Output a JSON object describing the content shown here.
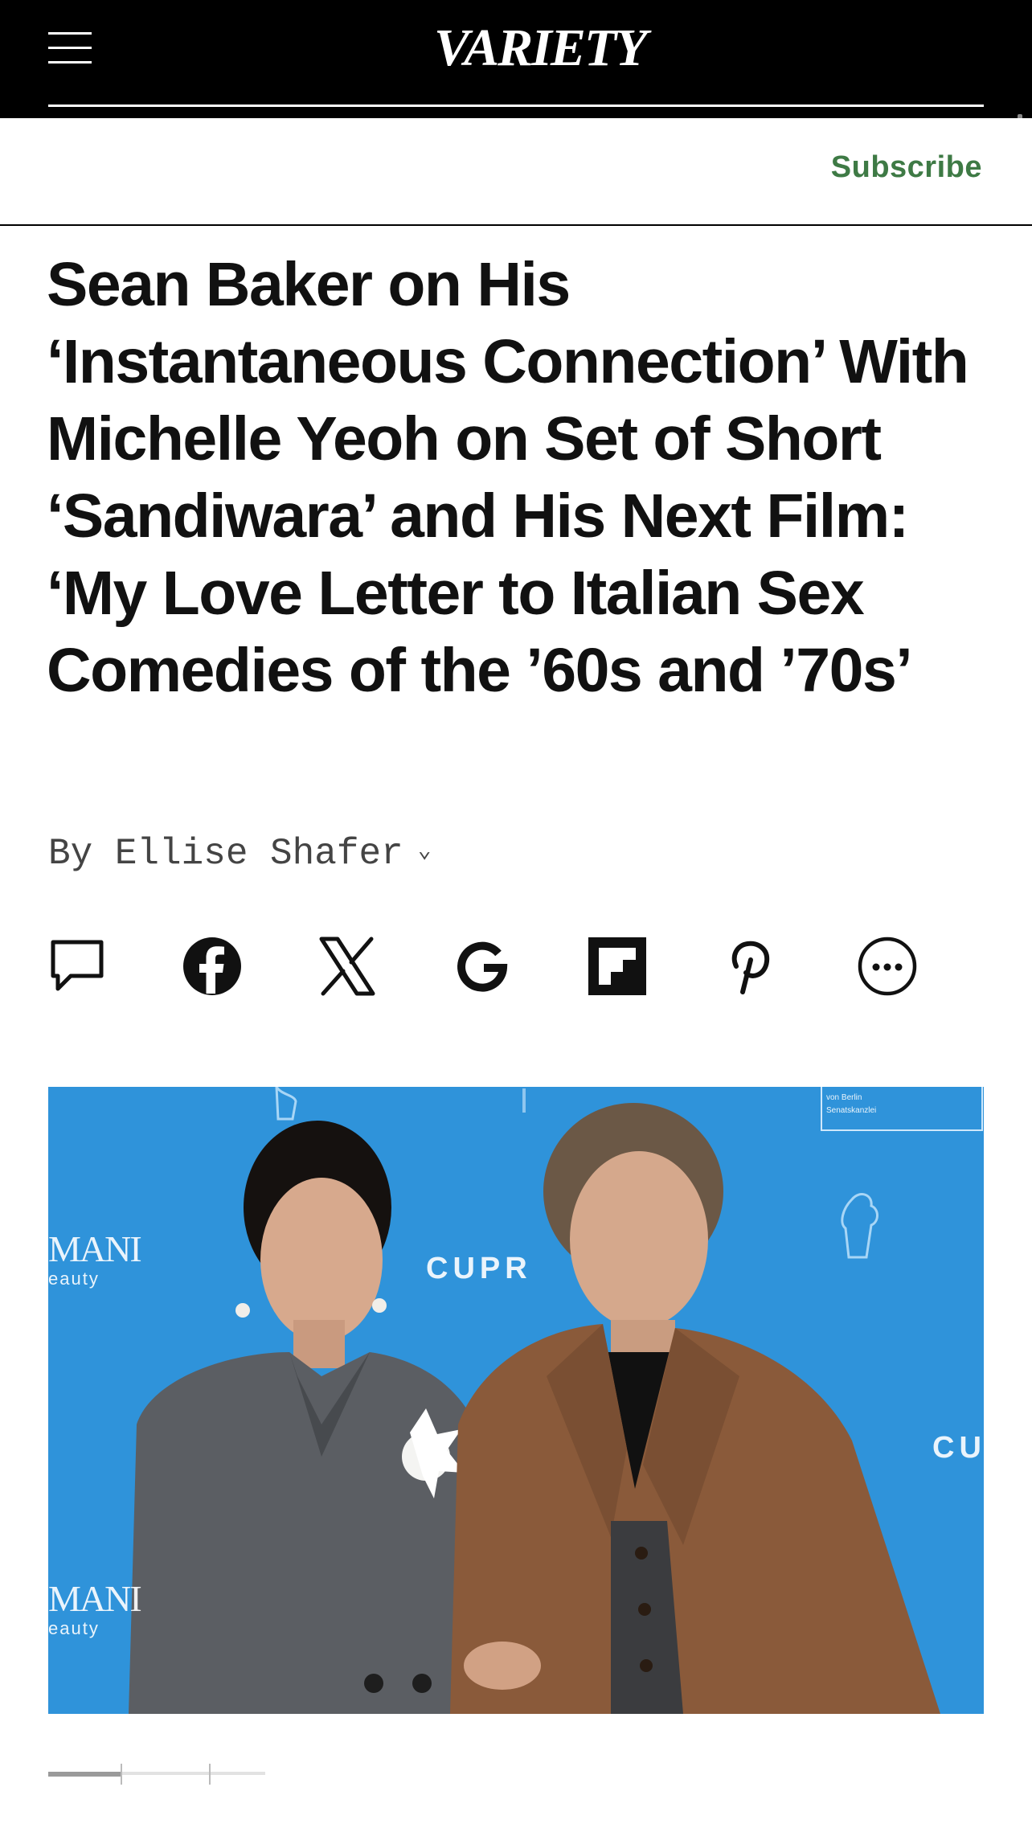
{
  "header": {
    "logo_text": "VARIETY",
    "subscribe_label": "Subscribe"
  },
  "article": {
    "headline": "Sean Baker on His ‘Instantaneous Connection’ With Michelle Yeoh on Set of Short ‘Sandiwara’ and His Next Film: ‘My Love Letter to Italian Sex Comedies of the ’60s and ’70s’",
    "byline_prefix": "By",
    "author": "Ellise Shafer",
    "author_chevron": "⌄"
  },
  "share_icons": [
    "comment-icon",
    "facebook-icon",
    "x-icon",
    "google-icon",
    "flipboard-icon",
    "pinterest-icon",
    "more-icon"
  ],
  "hero_image": {
    "backdrop_texts": {
      "left_brand_top": "MANI",
      "left_brand_top_sub": "eauty",
      "left_brand_bottom": "MANI",
      "left_brand_bottom_sub": "eauty",
      "center_sponsor": "CUPR",
      "right_sponsor": "CU",
      "corner_line1": "von Berlin",
      "corner_line2": "Senatskanzlei"
    },
    "colors": {
      "backdrop": "#2f93da",
      "jacket": "#8a5a3a",
      "suit": "#5b5e63"
    }
  },
  "colors": {
    "subscribe": "#3e7a45",
    "header_bg": "#000000"
  }
}
